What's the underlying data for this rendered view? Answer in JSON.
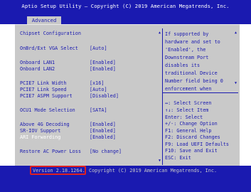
{
  "header": {
    "title": "Aptio Setup Utility – Copyright (C) 2019 American Megatrends, Inc.",
    "active_tab": "Advanced"
  },
  "menu": {
    "section_title": "Chipset Configuration",
    "items": [
      {
        "label": "OnBrd/Ext VGA Select",
        "value": "[Auto]"
      },
      {
        "label": "Onboard LAN1",
        "value": "[Enabled]"
      },
      {
        "label": "Onboard LAN2",
        "value": "[Enabled]"
      },
      {
        "label": "PCIE7 Link Width",
        "value": "[x16]"
      },
      {
        "label": "PCIE7 Link Speed",
        "value": "[Auto]"
      },
      {
        "label": "PCIE7 ASPM Support",
        "value": "[Disabled]"
      },
      {
        "label": "OCU1 Mode Selection",
        "value": "[SATA]"
      },
      {
        "label": "Above 4G Decoding",
        "value": "[Enabled]"
      },
      {
        "label": "SR-IOV Support",
        "value": "[Enabled]"
      },
      {
        "label": "ARI Forwarding",
        "value": "[Enabled]"
      },
      {
        "label": "Restore AC Power Loss",
        "value": "[No change]"
      }
    ]
  },
  "help_text": [
    "If supported by",
    "hardware and set to",
    "'Enabled', the",
    "Downstream Port",
    "disables its",
    "traditional Device",
    "Number field being 0",
    "enforcement when"
  ],
  "key_help": [
    "↔: Select Screen",
    "↑↓: Select Item",
    "Enter: Select",
    "+/-: Change Option",
    "F1: General Help",
    "F2: Discard Changes",
    "F9: Load UEFI Defaults",
    "F10: Save and Exit",
    "ESC: Exit"
  ],
  "footer": {
    "version": "Version 2.18.1264.",
    "copyright": "Copyright (C) 2019 American Megatrends, Inc."
  },
  "colors": {
    "bios_blue": "#1a1ab0",
    "panel_gray": "#c9c9c9",
    "highlight_white": "#ffffff",
    "annotation_red": "#e02020"
  }
}
